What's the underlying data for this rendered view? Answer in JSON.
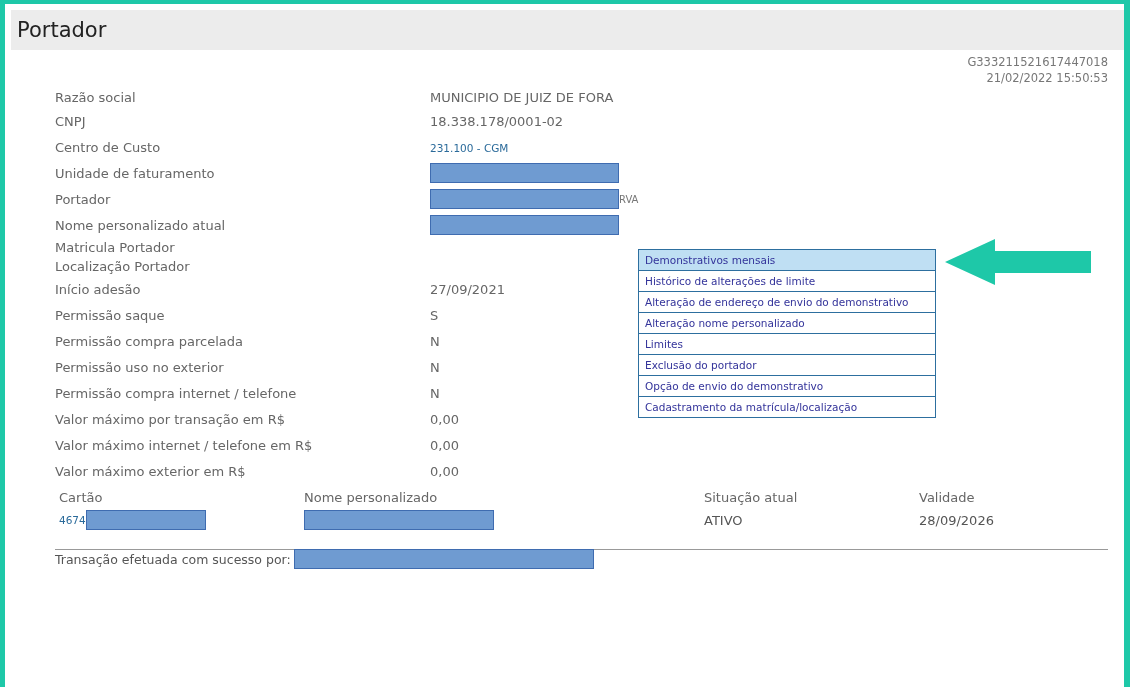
{
  "title": "Portador",
  "protocol": "G333211521617447018",
  "timestamp": "21/02/2022 15:50:53",
  "fields": [
    {
      "label": "Razão social",
      "kind": "text",
      "value": "MUNICIPIO DE JUIZ DE FORA"
    },
    {
      "label": "CNPJ",
      "kind": "text",
      "value": "18.338.178/0001-02"
    },
    {
      "label": "Centro de Custo",
      "kind": "link",
      "value": "231.100 - CGM"
    },
    {
      "label": "Unidade de faturamento",
      "kind": "redacted"
    },
    {
      "label": "Portador",
      "kind": "redacted",
      "value": "RVA"
    },
    {
      "label": "Nome personalizado atual",
      "kind": "redacted"
    },
    {
      "label": "Matricula Portador",
      "kind": "none"
    },
    {
      "label": "Localização Portador",
      "kind": "none"
    },
    {
      "label": "Início adesão",
      "kind": "text",
      "value": "27/09/2021"
    },
    {
      "label": "Permissão saque",
      "kind": "text",
      "value": "S"
    },
    {
      "label": "Permissão compra parcelada",
      "kind": "text",
      "value": "N"
    },
    {
      "label": "Permissão uso no exterior",
      "kind": "text",
      "value": "N"
    },
    {
      "label": "Permissão compra internet / telefone",
      "kind": "text",
      "value": "N"
    },
    {
      "label": "Valor máximo por transação em R$",
      "kind": "text",
      "value": "0,00"
    },
    {
      "label": "Valor máximo internet / telefone em R$",
      "kind": "text",
      "value": "0,00"
    },
    {
      "label": "Valor máximo exterior em R$",
      "kind": "text",
      "value": "0,00"
    }
  ],
  "menu": [
    {
      "label": "Demonstrativos mensais",
      "selected": true
    },
    {
      "label": "Histórico de alterações de limite",
      "selected": false
    },
    {
      "label": "Alteração de endereço de envio do demonstrativo",
      "selected": false
    },
    {
      "label": "Alteração nome personalizado",
      "selected": false
    },
    {
      "label": "Limites",
      "selected": false
    },
    {
      "label": "Exclusão do portador",
      "selected": false
    },
    {
      "label": "Opção de envio do demonstrativo",
      "selected": false
    },
    {
      "label": "Cadastramento da matrícula/localização",
      "selected": false
    }
  ],
  "cards": {
    "columns": [
      "Cartão",
      "Nome personalizado",
      "Situação atual",
      "Validade"
    ],
    "rows": [
      {
        "card_number": "4674",
        "status": "ATIVO",
        "validity": "28/09/2026"
      }
    ]
  },
  "footer": "Transação efetuada com sucesso por:"
}
